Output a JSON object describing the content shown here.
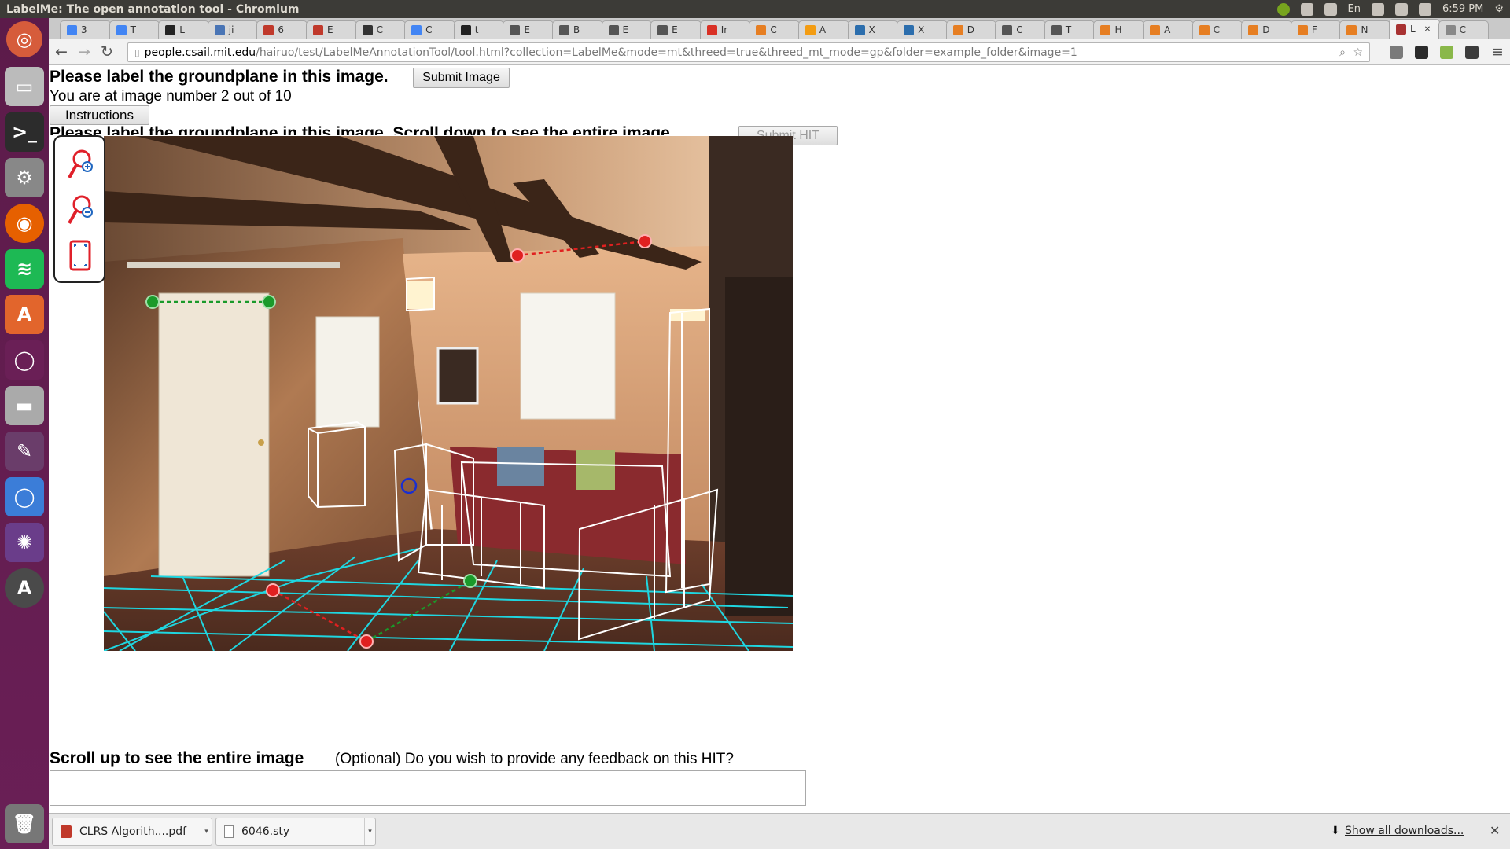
{
  "window": {
    "title": "LabelMe: The open annotation tool - Chromium"
  },
  "system_tray": {
    "time": "6:59 PM",
    "keyboard": "En"
  },
  "tabs": [
    {
      "label": "3",
      "color": "#4285f4"
    },
    {
      "label": "T",
      "color": "#4285f4"
    },
    {
      "label": "L",
      "color": "#222222"
    },
    {
      "label": "ji",
      "color": "#4a75b5"
    },
    {
      "label": "6",
      "color": "#c0392b"
    },
    {
      "label": "E",
      "color": "#c0392b"
    },
    {
      "label": "C",
      "color": "#333333"
    },
    {
      "label": "C",
      "color": "#4285f4"
    },
    {
      "label": "t",
      "color": "#222222"
    },
    {
      "label": "E",
      "color": "#555555"
    },
    {
      "label": "B",
      "color": "#555555"
    },
    {
      "label": "E",
      "color": "#555555"
    },
    {
      "label": "E",
      "color": "#555555"
    },
    {
      "label": "Ir",
      "color": "#d93025"
    },
    {
      "label": "C",
      "color": "#e67e22"
    },
    {
      "label": "A",
      "color": "#f39c12"
    },
    {
      "label": "X",
      "color": "#2c6ead"
    },
    {
      "label": "X",
      "color": "#2c6ead"
    },
    {
      "label": "D",
      "color": "#e67e22"
    },
    {
      "label": "C",
      "color": "#555555"
    },
    {
      "label": "T",
      "color": "#555555"
    },
    {
      "label": "H",
      "color": "#e67e22"
    },
    {
      "label": "A",
      "color": "#e67e22"
    },
    {
      "label": "C",
      "color": "#e67e22"
    },
    {
      "label": "D",
      "color": "#e67e22"
    },
    {
      "label": "F",
      "color": "#e67e22"
    },
    {
      "label": "N",
      "color": "#e67e22"
    },
    {
      "label": "L",
      "color": "#a83232",
      "active": true
    },
    {
      "label": "C",
      "color": "#888888"
    }
  ],
  "address_bar": {
    "host": "people.csail.mit.edu",
    "path": "/hairuo/test/LabelMeAnnotationTool/tool.html?collection=LabelMe&mode=mt&threed=true&threed_mt_mode=gp&folder=example_folder&image=1"
  },
  "page": {
    "heading": "Please label the groundplane in this image.",
    "submit_image_label": "Submit Image",
    "progress": "You are at image number 2 out of 10",
    "instructions_label": "Instructions",
    "hidden_heading": "Please label the groundplane in this image. Scroll down to see the entire image.",
    "submit_hit_label": "Submit HIT",
    "footer_heading": "Scroll up to see the entire image",
    "feedback_question": "(Optional) Do you wish to provide any feedback on this HIT?",
    "feedback_value": ""
  },
  "annotation_colors": {
    "grid": "#1fd6e0",
    "boxes": "#ffffff",
    "red_line": "#e02020",
    "green_line": "#1a9a2a",
    "blue_point": "#1a2fd0"
  },
  "downloads": [
    {
      "name": "CLRS Algorith....pdf",
      "icon": "pdf-icon"
    },
    {
      "name": "6046.sty",
      "icon": "file-icon"
    }
  ],
  "downloads_show_all": "Show all downloads..."
}
